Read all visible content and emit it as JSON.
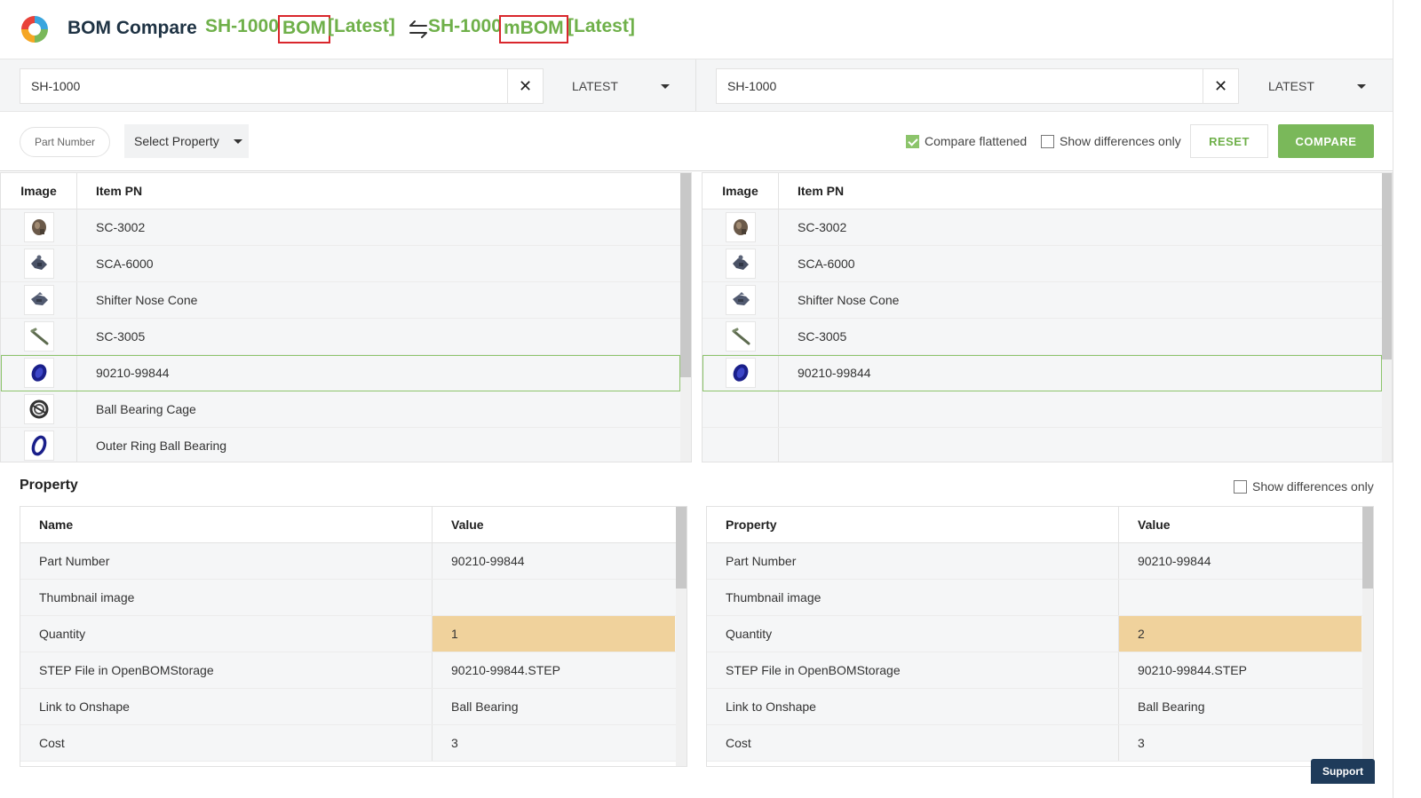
{
  "header": {
    "app_title": "BOM Compare",
    "left_pn": "SH-1000",
    "left_type": "BOM",
    "left_rev": "[Latest]",
    "right_pn": "SH-1000",
    "right_type": "mBOM",
    "right_rev": "[Latest]"
  },
  "search": {
    "left": {
      "value": "SH-1000",
      "revision": "LATEST"
    },
    "right": {
      "value": "SH-1000",
      "revision": "LATEST"
    }
  },
  "filters": {
    "pill": "Part Number",
    "select_property": "Select Property",
    "compare_flattened": "Compare flattened",
    "show_diff": "Show differences only",
    "reset": "RESET",
    "compare": "COMPARE"
  },
  "items": {
    "col_image": "Image",
    "col_pn": "Item PN",
    "left": [
      {
        "pn": "SC-3002",
        "icon": "gear-housing-icon"
      },
      {
        "pn": "SCA-6000",
        "icon": "shifter-assembly-icon"
      },
      {
        "pn": "Shifter Nose Cone",
        "icon": "nose-cone-icon"
      },
      {
        "pn": "SC-3005",
        "icon": "rod-icon"
      },
      {
        "pn": "90210-99844",
        "icon": "bearing-icon"
      },
      {
        "pn": "Ball Bearing Cage",
        "icon": "bearing-cage-icon"
      },
      {
        "pn": "Outer Ring Ball Bearing",
        "icon": "outer-ring-icon"
      }
    ],
    "right": [
      {
        "pn": "SC-3002",
        "icon": "gear-housing-icon"
      },
      {
        "pn": "SCA-6000",
        "icon": "shifter-assembly-icon"
      },
      {
        "pn": "Shifter Nose Cone",
        "icon": "nose-cone-icon"
      },
      {
        "pn": "SC-3005",
        "icon": "rod-icon"
      },
      {
        "pn": "90210-99844",
        "icon": "bearing-icon"
      }
    ]
  },
  "property": {
    "title": "Property",
    "show_diff": "Show differences only",
    "left_headers": {
      "name": "Name",
      "value": "Value"
    },
    "right_headers": {
      "name": "Property",
      "value": "Value"
    },
    "rows": [
      {
        "name": "Part Number",
        "left": "90210-99844",
        "right": "90210-99844"
      },
      {
        "name": "Thumbnail image",
        "left": "",
        "right": ""
      },
      {
        "name": "Quantity",
        "left": "1",
        "right": "2"
      },
      {
        "name": "STEP File in OpenBOMStorage",
        "left": "90210-99844.STEP",
        "right": "90210-99844.STEP"
      },
      {
        "name": "Link to Onshape",
        "left": "Ball Bearing",
        "right": "Ball Bearing"
      },
      {
        "name": "Cost",
        "left": "3",
        "right": "3"
      }
    ]
  },
  "support": "Support",
  "colors": {
    "accent": "#6fb04a",
    "diff": "#f0d29c",
    "highlight_box": "#d9262c"
  }
}
